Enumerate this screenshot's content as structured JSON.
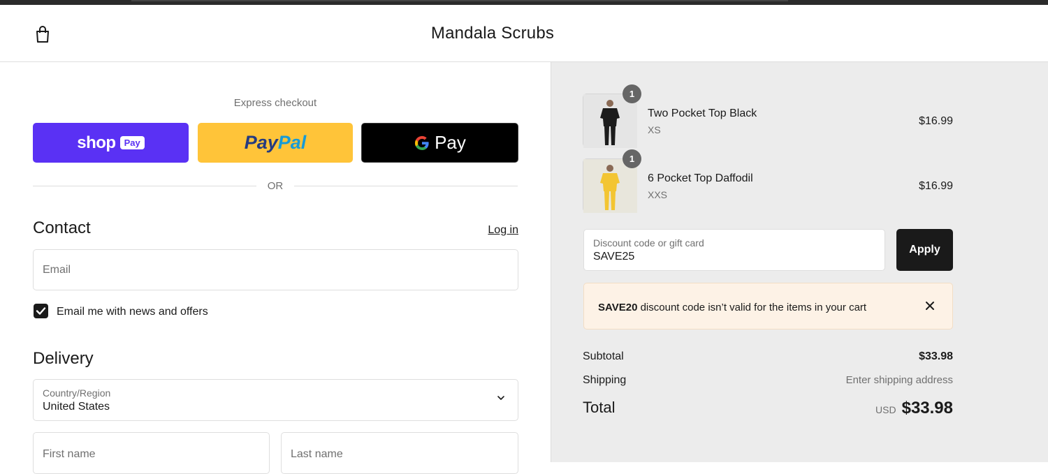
{
  "header": {
    "store_title": "Mandala Scrubs",
    "cart_icon": "shopping-bag-icon"
  },
  "express": {
    "label": "Express checkout",
    "shop_pay": {
      "word": "shop",
      "badge": "Pay"
    },
    "paypal": {
      "part1": "Pay",
      "part2": "Pal"
    },
    "gpay": {
      "g": "G",
      "word": "Pay"
    },
    "or_text": "OR"
  },
  "contact": {
    "heading": "Contact",
    "login_label": "Log in",
    "email_placeholder": "Email",
    "newsletter_label": "Email me with news and offers",
    "newsletter_checked": true
  },
  "delivery": {
    "heading": "Delivery",
    "country_label": "Country/Region",
    "country_value": "United States",
    "first_name_placeholder": "First name",
    "last_name_placeholder": "Last name"
  },
  "cart": {
    "items": [
      {
        "name": "Two Pocket Top Black",
        "variant": "XS",
        "price": "$16.99",
        "qty": "1",
        "color": "#1c1c1c"
      },
      {
        "name": "6 Pocket Top Daffodil",
        "variant": "XXS",
        "price": "$16.99",
        "qty": "1",
        "color": "#f3c532"
      }
    ],
    "discount_label": "Discount code or gift card",
    "discount_value": "SAVE25",
    "apply_label": "Apply",
    "error": {
      "code": "SAVE20",
      "message": " discount code isn’t valid for the items in your cart"
    },
    "summary": {
      "subtotal_label": "Subtotal",
      "subtotal_value": "$33.98",
      "shipping_label": "Shipping",
      "shipping_value": "Enter shipping address",
      "total_label": "Total",
      "total_currency": "USD",
      "total_value": "$33.98"
    }
  },
  "colors": {
    "shop_pay": "#5a31f4",
    "paypal": "#ffc439",
    "gpay": "#000000",
    "summary_bg": "#ececec",
    "error_bg": "#fdf2e6"
  }
}
